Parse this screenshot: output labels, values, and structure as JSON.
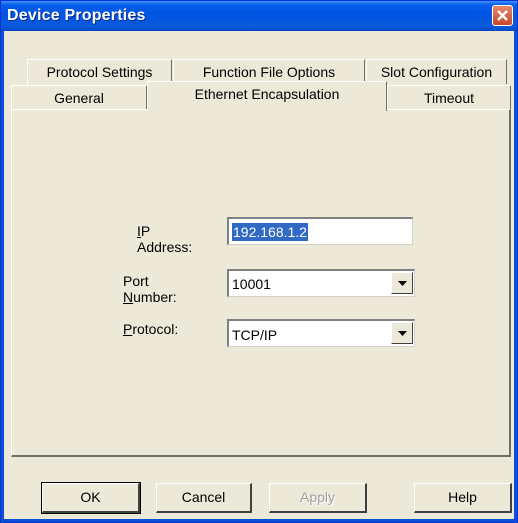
{
  "window": {
    "title": "Device Properties"
  },
  "tabs": {
    "row1": [
      "Protocol Settings",
      "Function File Options",
      "Slot Configuration"
    ],
    "row2": [
      "General",
      "Ethernet Encapsulation",
      "Timeout"
    ],
    "selected": "Ethernet Encapsulation"
  },
  "form": {
    "ip_label_accel": "I",
    "ip_label_rest": "P Address:",
    "ip_value": "192.168.1.2",
    "port_label_pre": "Port ",
    "port_label_accel": "N",
    "port_label_rest": "umber:",
    "port_value": "10001",
    "protocol_label_accel": "P",
    "protocol_label_rest": "rotocol:",
    "protocol_value": "TCP/IP"
  },
  "buttons": {
    "ok": "OK",
    "cancel": "Cancel",
    "apply": "Apply",
    "help": "Help"
  },
  "colors": {
    "title_bar": "#0054E3",
    "face": "#ECE9D8",
    "selection": "#316AC5",
    "close": "#C8452A"
  }
}
